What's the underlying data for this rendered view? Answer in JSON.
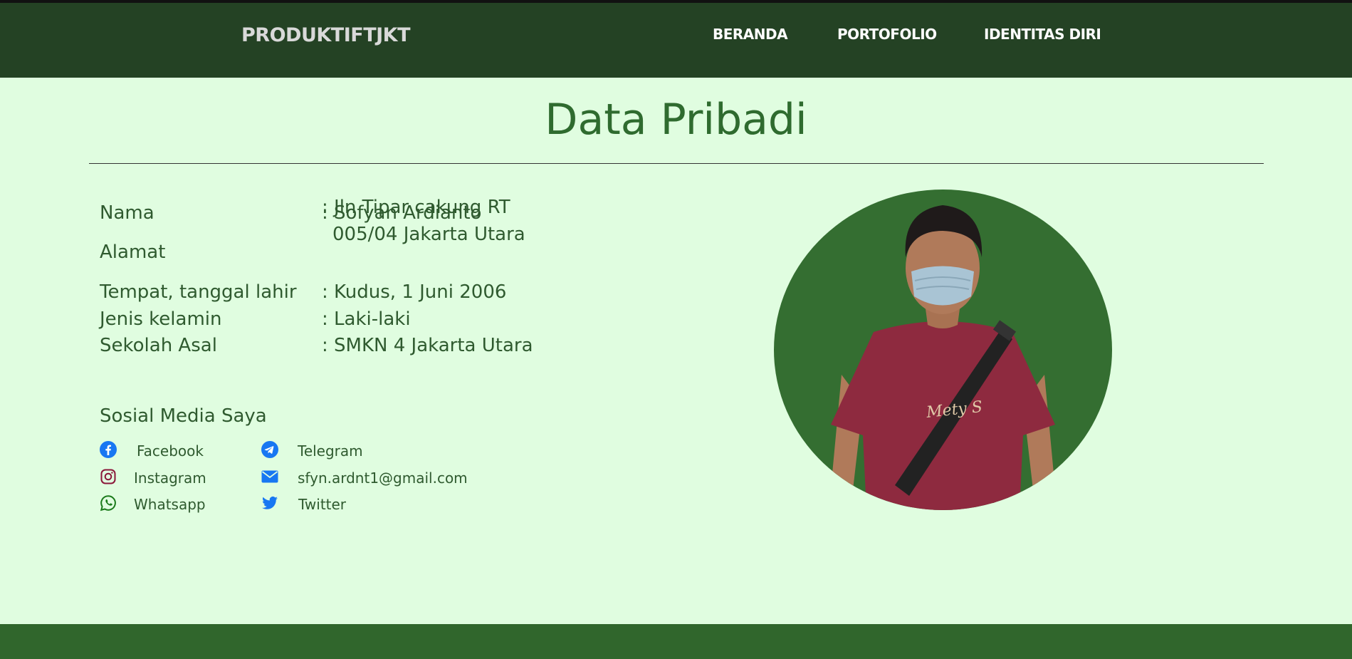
{
  "navbar": {
    "brand": "PRODUKTIFTJKT",
    "links": [
      "BERANDA",
      "PORTOFOLIO",
      "IDENTITAS DIRI"
    ]
  },
  "page": {
    "title": "Data Pribadi"
  },
  "personal": {
    "name_label": "Nama",
    "name_value": ": Sofyan Ardianto",
    "address_label": "Alamat",
    "address_value_line1": ": Jln Tipar cakung RT",
    "address_value_line2": "005/04 Jakarta Utara",
    "birth_label": "Tempat, tanggal lahir",
    "birth_value": ": Kudus, 1 Juni 2006",
    "gender_label": "Jenis kelamin",
    "gender_value": ": Laki-laki",
    "school_label": "Sekolah Asal",
    "school_value": ": SMKN 4 Jakarta Utara"
  },
  "social": {
    "title": "Sosial Media Saya",
    "facebook": "Facebook",
    "telegram": "Telegram",
    "instagram": "Instagram",
    "email": "sfyn.ardnt1@gmail.com",
    "whatsapp": "Whatsapp",
    "twitter": "Twitter"
  },
  "colors": {
    "navbar": "#244224",
    "background": "#e0fde0",
    "accent": "#2f6b2f",
    "footer": "#30662c",
    "icon_blue": "#1877f2",
    "icon_instagram": "#8a1538",
    "icon_whatsapp": "#1a7a1a"
  },
  "icons": {
    "facebook": "facebook-icon",
    "telegram": "telegram-icon",
    "instagram": "instagram-icon",
    "email": "envelope-icon",
    "whatsapp": "whatsapp-icon",
    "twitter": "twitter-icon"
  }
}
